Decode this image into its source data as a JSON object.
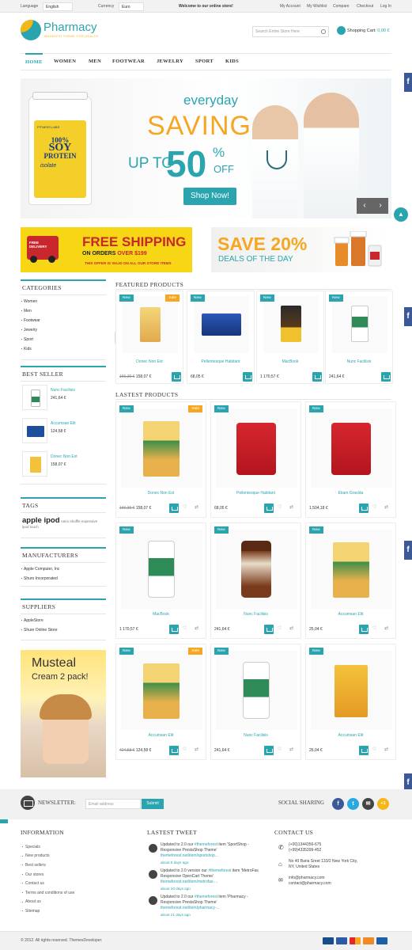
{
  "topbar": {
    "language_label": "Language",
    "language_value": "English",
    "currency_label": "Currency",
    "currency_value": "Euro",
    "welcome": "Welcome to our online store!",
    "links": [
      "My Account",
      "My Wishlist",
      "Compare",
      "Checkout",
      "Log In"
    ]
  },
  "header": {
    "logo_name": "Pharmacy",
    "logo_sub": "MAGENTO THEME FOR HEALTH",
    "search_placeholder": "Search Entire Store Here",
    "cart_label": "Shopping Cart",
    "cart_amount": "0,00 €"
  },
  "nav": [
    "HOME",
    "WOMEN",
    "MEN",
    "FOOTWEAR",
    "JEWELRY",
    "SPORT",
    "KIDS"
  ],
  "banner": {
    "product_brand": "FITNESS LABS",
    "product_line1": "100%",
    "product_line2": "SOY",
    "product_line3": "PROTEIN",
    "product_line4": "isolate",
    "everyday": "everyday",
    "saving": "SAVING",
    "upto": "UP TO",
    "fifty": "50",
    "pct": "%",
    "off": "OFF",
    "button": "Shop Now!"
  },
  "promo1": {
    "truck_text": "FREE DELIVERY",
    "headline": "FREE SHIPPING",
    "line2_a": "ON ORDERS ",
    "line2_b": "OVER $199",
    "line3": "THIS OFFER IS VALID ON ALL OUR STORE ITEMS"
  },
  "promo2": {
    "headline": "SAVE 20%",
    "sub": "DEALS OF THE DAY"
  },
  "sidebar": {
    "categories_title": "CATEGORIES",
    "categories": [
      "Women",
      "Men",
      "Footwear",
      "Jewelry",
      "Sport",
      "Kids"
    ],
    "bestseller_title": "BEST SELLER",
    "bestsellers": [
      {
        "name": "Nunc Facilisis",
        "price": "241,64 €"
      },
      {
        "name": "Accumsan Elit",
        "price": "124,58 €"
      },
      {
        "name": "Donec Non Est",
        "price": "158,07 €"
      }
    ],
    "tags_title": "TAGS",
    "tags_big": "apple ipod",
    "tags_small": "nano shuffle expensive",
    "tags_small2": "ipod touch",
    "manufacturers_title": "MANUFACTURERS",
    "manufacturers": [
      "Apple Computer, Inc",
      "Shuro Incorporated"
    ],
    "suppliers_title": "SUPPLIERS",
    "suppliers": [
      "AppleStore",
      "Shure Online Store"
    ],
    "ad_line1": "Musteal",
    "ad_line2": "Cream 2 pack!"
  },
  "featured": {
    "title": "FEATURED PRODUCTS",
    "products": [
      {
        "name": "Donec Non Est",
        "badge_new": "New",
        "badge_sale": "Sale",
        "price_old": "166,39 €",
        "price": "158,07 €"
      },
      {
        "name": "Pellentesque Habitant",
        "badge_new": "New",
        "badge_sale": "",
        "price_old": "",
        "price": "68,05 €"
      },
      {
        "name": "MacBook",
        "badge_new": "New",
        "badge_sale": "",
        "price_old": "",
        "price": "1 170,57 €"
      },
      {
        "name": "Nunc Facilisis",
        "badge_new": "New",
        "badge_sale": "",
        "price_old": "",
        "price": "241,64 €"
      }
    ]
  },
  "latest": {
    "title": "LASTEST PRODUCTS",
    "products": [
      {
        "name": "Donec Non Est",
        "badge_new": "New",
        "badge_sale": "Sale",
        "price_old": "166,39 €",
        "price": "158,07 €"
      },
      {
        "name": "Pellentesque Habitant",
        "badge_new": "New",
        "badge_sale": "",
        "price_old": "",
        "price": "68,05 €"
      },
      {
        "name": "Etiam Gravida",
        "badge_new": "New",
        "badge_sale": "",
        "price_old": "",
        "price": "1.504,18 €"
      },
      {
        "name": "MacBook",
        "badge_new": "New",
        "badge_sale": "",
        "price_old": "",
        "price": "1 170,57 €"
      },
      {
        "name": "Nunc Facilisis",
        "badge_new": "New",
        "badge_sale": "",
        "price_old": "",
        "price": "241,64 €"
      },
      {
        "name": "Accumsan Elit",
        "badge_new": "New",
        "badge_sale": "",
        "price_old": "",
        "price": "25,04 €"
      },
      {
        "name": "Accumsan Elit",
        "badge_new": "New",
        "badge_sale": "Sale",
        "price_old": "424,58 €",
        "price": "124,58 €"
      },
      {
        "name": "Nunc Facilisis",
        "badge_new": "New",
        "badge_sale": "",
        "price_old": "",
        "price": "241,64 €"
      },
      {
        "name": "Accumsan Elit",
        "badge_new": "New",
        "badge_sale": "",
        "price_old": "",
        "price": "26,04 €"
      }
    ]
  },
  "newsletter": {
    "label": "NEWSLETTER:",
    "placeholder": "Email address",
    "button": "Submit",
    "social_label": "SOCIAL SHARING",
    "social": [
      "f",
      "t",
      "✉",
      "+1"
    ]
  },
  "footer": {
    "info_title": "INFORMATION",
    "info_links": [
      "Specials",
      "New products",
      "Best sellers",
      "Our stores",
      "Contact us",
      "Terms and conditions of use",
      "About us",
      "Sitemap"
    ],
    "tweet_title": "LASTEST TWEET",
    "tweets": [
      {
        "a": "Updated to 2.0 our ",
        "h": "#themeforest",
        "b": " item 'SportShop - Responsive PrestaShop Theme'",
        "link": "themeforest.net/item/sportshop...",
        "ago": "about 5 days ago"
      },
      {
        "a": "Updated to 2.0 version our ",
        "h": "#themeforest",
        "b": " item 'MetroFas Responsive OpenCart Theme'",
        "link": "themeforest.net/item/metrofas-...",
        "ago": "about 20 days ago"
      },
      {
        "a": "Updated to 2.0 our ",
        "h": "#themeforest",
        "b": " item 'Pharmacy - Responsive PrestaShop Theme'",
        "link": "themeforest.net/item/pharmacy-...",
        "ago": "about 21 days ago"
      }
    ],
    "contact_title": "CONTACT US",
    "phone1": "(+00)1344356-675",
    "phone2": "(+99)4335399-452",
    "address1": "No 40 Baria Sreet 133/2 New York City,",
    "address2": "NY, United States",
    "email1": "info@pharmacy.com",
    "email2": "contact@pharmacy.com",
    "copyright": "© 2012. All rights reserved. ThemesDeveloper."
  },
  "colors": {
    "accent": "#2aa5b0",
    "sale": "#f6a623",
    "facebook": "#3b5998"
  }
}
